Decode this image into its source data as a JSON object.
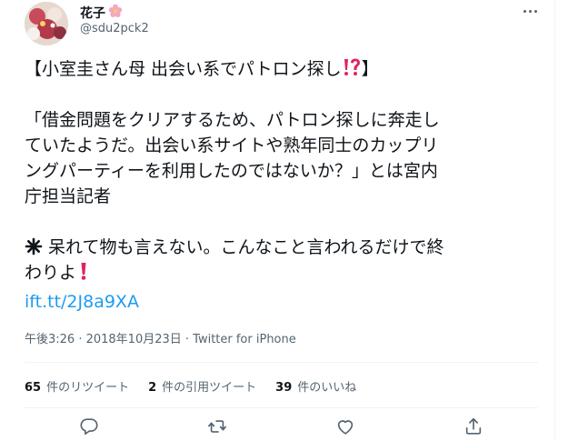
{
  "author": {
    "display_name": "花子",
    "handle": "@sdu2pck2",
    "name_badge_icon": "cherry-blossom-icon"
  },
  "tweet": {
    "line1": "【小室圭さん母 出会い系でパトロン探し",
    "line1_emoji_icon": "exclamation-question-icon",
    "line1_end": "】",
    "quote_lines": [
      "「借金問題をクリアするため、パトロン探しに奔走し",
      "ていたようだ。出会い系サイトや熟年同士のカップリ",
      "ングパーティーを利用したのではないか？」とは宮内",
      "庁担当記者"
    ],
    "comment_line1": "呆れて物も言えない。こんなこと言われるだけで終",
    "comment_line1_icon": "eight-pointed-star-icon",
    "comment_line2": "わりよ",
    "comment_line2_icon": "red-exclamation-icon",
    "link": "ift.tt/2J8a9XA"
  },
  "meta": {
    "timestamp": "午後3:26 · 2018年10月23日 · Twitter for iPhone"
  },
  "stats": {
    "retweets_count": "65",
    "retweets_label": "件のリツイート",
    "quotes_count": "2",
    "quotes_label": "件の引用ツイート",
    "likes_count": "39",
    "likes_label": "件のいいね"
  },
  "colors": {
    "link": "#1d9bf0",
    "secondary_text": "#536471",
    "exclamation_red": "#e0245e"
  }
}
